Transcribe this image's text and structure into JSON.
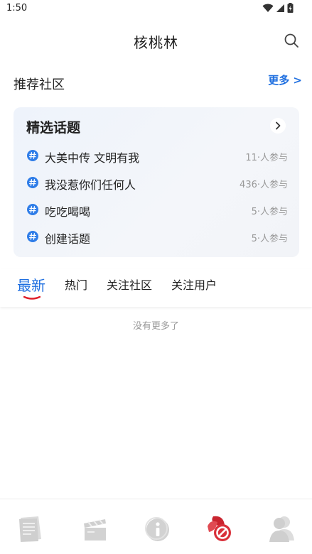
{
  "status_bar": {
    "time": "1:50"
  },
  "header": {
    "title": "核桃林"
  },
  "recommended": {
    "title": "推荐社区",
    "more_label": "更多 >"
  },
  "featured_topics": {
    "title": "精选话题",
    "items": [
      {
        "name": "大美中传 文明有我",
        "count": "11·人参与"
      },
      {
        "name": "我没惹你们任何人",
        "count": "436·人参与"
      },
      {
        "name": "吃吃喝喝",
        "count": "5·人参与"
      },
      {
        "name": "创建话题",
        "count": "5·人参与"
      }
    ]
  },
  "tabs": [
    {
      "label": "最新",
      "active": true
    },
    {
      "label": "热门",
      "active": false
    },
    {
      "label": "关注社区",
      "active": false
    },
    {
      "label": "关注用户",
      "active": false
    }
  ],
  "feed": {
    "empty_text": "没有更多了"
  },
  "bottom_nav": [
    {
      "icon": "newspaper-icon",
      "active": false
    },
    {
      "icon": "clapperboard-icon",
      "active": false
    },
    {
      "icon": "info-icon",
      "active": false
    },
    {
      "icon": "community-icon",
      "active": true
    },
    {
      "icon": "user-profile-icon",
      "active": false
    }
  ],
  "colors": {
    "accent": "#1f6fe0",
    "active_nav": "#d9303a",
    "underline": "#e0202b",
    "inactive_icon": "#d8d8d8"
  }
}
